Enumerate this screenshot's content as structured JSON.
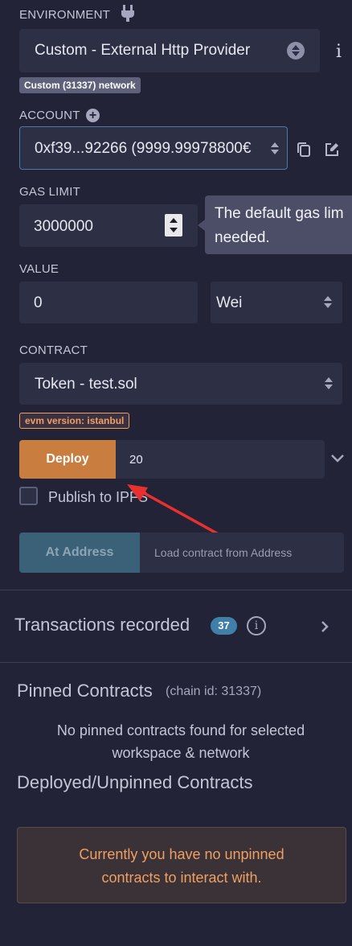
{
  "environment": {
    "label": "ENVIRONMENT",
    "plug_icon": "plug-icon",
    "selected": "Custom - External Http Provider",
    "info_icon": "i",
    "network_badge": "Custom (31337) network"
  },
  "account": {
    "label": "ACCOUNT",
    "selected": "0xf39...92266 (9999.99978800€",
    "add_icon": "+"
  },
  "gas_limit": {
    "label": "GAS LIMIT",
    "value": "3000000",
    "tooltip_line1": "The default gas lim",
    "tooltip_line2": "needed."
  },
  "value": {
    "label": "VALUE",
    "amount": "0",
    "unit": "Wei"
  },
  "contract": {
    "label": "CONTRACT",
    "selected": "Token - test.sol",
    "evm_badge": "evm version: istanbul"
  },
  "deploy": {
    "button": "Deploy",
    "input": "20",
    "publish_label": "Publish to IPFS"
  },
  "at_address": {
    "button": "At Address",
    "placeholder": "Load contract from Address"
  },
  "transactions": {
    "title": "Transactions recorded",
    "count": "37"
  },
  "pinned": {
    "title": "Pinned Contracts",
    "chain": "(chain id: 31337)",
    "empty_line1": "No pinned contracts found for selected",
    "empty_line2": "workspace & network"
  },
  "deployed": {
    "title": "Deployed/Unpinned Contracts",
    "empty_line1": "Currently you have no unpinned",
    "empty_line2": "contracts to interact with."
  },
  "colors": {
    "background": "#222336",
    "field": "#2d2f45",
    "deploy_orange": "#c97d3f",
    "at_address_blue": "#3b6178",
    "arrow_red": "#e8312f",
    "warning_box": "#3a3237",
    "warning_text": "#ef9f63"
  }
}
